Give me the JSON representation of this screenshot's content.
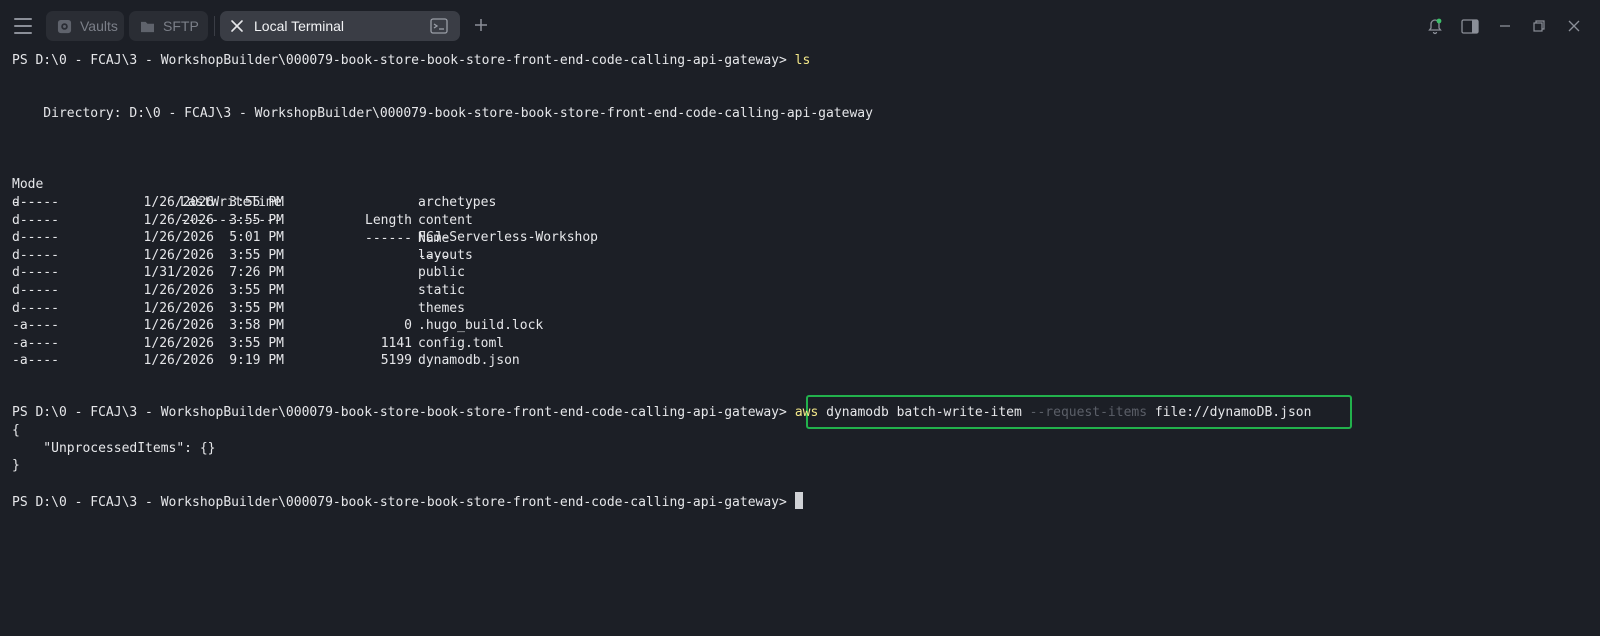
{
  "tabs": [
    {
      "label": "Vaults"
    },
    {
      "label": "SFTP"
    },
    {
      "label": "Local Terminal"
    }
  ],
  "colors": {
    "background": "#1c1f26",
    "highlight_border": "#22b14c",
    "command_text": "#f5e98a",
    "notification_icon": "#3cc06a"
  },
  "terminal": {
    "prompt": "PS D:\\0 - FCAJ\\3 - WorkshopBuilder\\000079-book-store-book-store-front-end-code-calling-api-gateway>",
    "first_command": "ls",
    "directory_line": "    Directory: D:\\0 - FCAJ\\3 - WorkshopBuilder\\000079-book-store-book-store-front-end-code-calling-api-gateway",
    "headers": {
      "mode": "Mode",
      "lastwritetime": "LastWriteTime",
      "length": "Length",
      "name": "Name"
    },
    "underlines": {
      "mode": "----",
      "lastwritetime": "-------------",
      "length": "------",
      "name": "----"
    },
    "rows": [
      {
        "mode": "d-----",
        "date": "1/26/2026",
        "time": "3:55 PM",
        "length": "",
        "name": "archetypes"
      },
      {
        "mode": "d-----",
        "date": "1/26/2026",
        "time": "3:55 PM",
        "length": "",
        "name": "content"
      },
      {
        "mode": "d-----",
        "date": "1/26/2026",
        "time": "5:01 PM",
        "length": "",
        "name": "FCJ-Serverless-Workshop"
      },
      {
        "mode": "d-----",
        "date": "1/26/2026",
        "time": "3:55 PM",
        "length": "",
        "name": "layouts"
      },
      {
        "mode": "d-----",
        "date": "1/31/2026",
        "time": "7:26 PM",
        "length": "",
        "name": "public"
      },
      {
        "mode": "d-----",
        "date": "1/26/2026",
        "time": "3:55 PM",
        "length": "",
        "name": "static"
      },
      {
        "mode": "d-----",
        "date": "1/26/2026",
        "time": "3:55 PM",
        "length": "",
        "name": "themes"
      },
      {
        "mode": "-a----",
        "date": "1/26/2026",
        "time": "3:58 PM",
        "length": "0",
        "name": ".hugo_build.lock"
      },
      {
        "mode": "-a----",
        "date": "1/26/2026",
        "time": "3:55 PM",
        "length": "1141",
        "name": "config.toml"
      },
      {
        "mode": "-a----",
        "date": "1/26/2026",
        "time": "9:19 PM",
        "length": "5199",
        "name": "dynamodb.json"
      }
    ],
    "second_command": {
      "aws": "aws",
      "args": "dynamodb batch-write-item",
      "option": "--request-items",
      "value": "file://dynamoDB.json"
    },
    "output": {
      "open": "{",
      "body": "    \"UnprocessedItems\": {}",
      "close": "}"
    }
  }
}
